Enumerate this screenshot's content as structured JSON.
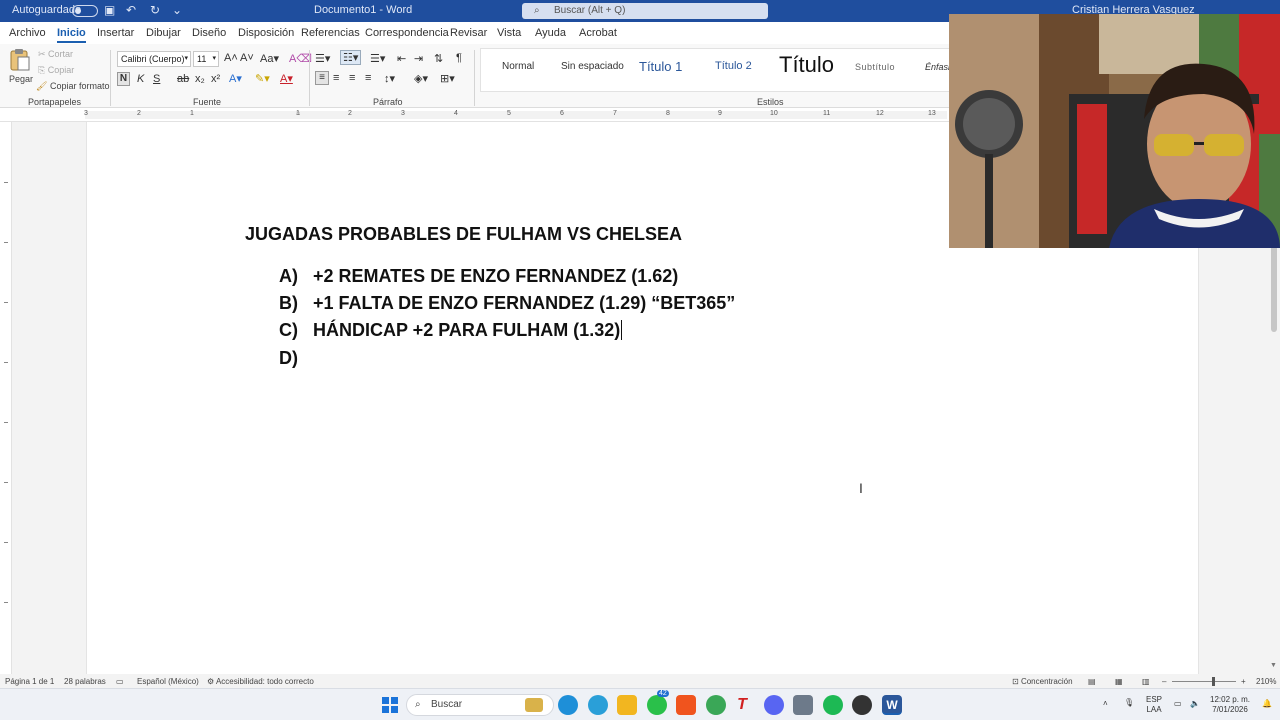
{
  "titlebar": {
    "autosave_label": "Autoguardado",
    "doc_title": "Documento1 - Word",
    "search_placeholder": "Buscar (Alt + Q)",
    "user_name": "Cristian Herrera Vasquez"
  },
  "tabs": [
    "Archivo",
    "Inicio",
    "Insertar",
    "Dibujar",
    "Diseño",
    "Disposición",
    "Referencias",
    "Correspondencia",
    "Revisar",
    "Vista",
    "Ayuda",
    "Acrobat"
  ],
  "active_tab": "Inicio",
  "ribbon": {
    "clipboard": {
      "paste_label": "Pegar",
      "cut_label": "Cortar",
      "copy_label": "Copiar",
      "format_painter_label": "Copiar formato",
      "group_label": "Portapapeles"
    },
    "font": {
      "font_name": "Calibri (Cuerpo)",
      "font_size": "11",
      "group_label": "Fuente"
    },
    "paragraph": {
      "group_label": "Párrafo"
    },
    "styles": {
      "items": [
        "Normal",
        "Sin espaciado",
        "Título 1",
        "Título 2",
        "Título",
        "Subtítulo",
        "Énfasis"
      ],
      "group_label": "Estilos"
    }
  },
  "ruler_numbers": [
    "3",
    "2",
    "1",
    "1",
    "2",
    "3",
    "4",
    "5",
    "6",
    "7",
    "8",
    "9",
    "10",
    "11",
    "12",
    "13"
  ],
  "document": {
    "title": "JUGADAS PROBABLES DE FULHAM VS CHELSEA",
    "items": [
      {
        "letter": "A)",
        "text": "+2 REMATES DE ENZO FERNANDEZ (1.62)"
      },
      {
        "letter": "B)",
        "text": "+1 FALTA DE ENZO FERNANDEZ (1.29) “BET365”"
      },
      {
        "letter": "C)",
        "text": "HÁNDICAP +2 PARA FULHAM (1.32)"
      },
      {
        "letter": "D)",
        "text": ""
      }
    ]
  },
  "statusbar": {
    "page": "Página 1 de 1",
    "words": "28 palabras",
    "language": "Español (México)",
    "accessibility": "Accesibilidad: todo correcto",
    "focus": "Concentración",
    "zoom": "210%"
  },
  "taskbar": {
    "search_label": "Buscar",
    "badge_count": "42",
    "lang_top": "ESP",
    "lang_bottom": "LAA",
    "time": "12:02 p. m.",
    "date": "7/01/2026"
  },
  "colors": {
    "titlebar": "#1f4e9e",
    "accent": "#1b5fb0"
  }
}
